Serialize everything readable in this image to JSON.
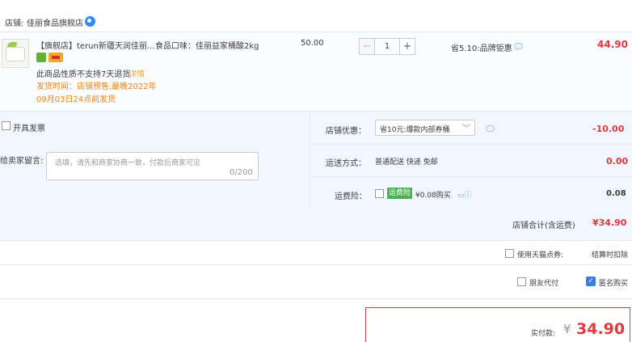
{
  "shop": {
    "label": "店铺:",
    "name": "佳丽食品旗舰店"
  },
  "item": {
    "title": "【旗舰店】terun新疆天润佳丽...",
    "sku": "食品口味：佳丽益家桶酸2kg",
    "price": "50.00",
    "quantity": "1",
    "minus": "−",
    "plus": "+",
    "promo": "省5.10:品牌钜惠",
    "subtotal": "44.90",
    "no_return": "此商品性质不支持7天退货",
    "detail_link": "详情",
    "ship_time_line1": "发货时间：店铺预售,最晚2022年",
    "ship_time_line2": "09月03日24点前发货"
  },
  "options": {
    "invoice_label": "开具发票",
    "memo_label": "给卖家留言:",
    "memo_placeholder": "选填，请先和商家协商一致，付款后商家可见",
    "memo_count": "0/200",
    "coupon_label": "店铺优惠：",
    "coupon_value": "省10元:爆款内部券桶",
    "discount": "-10.00",
    "shipping_label": "运送方式：",
    "shipping_method": "普通配送 快递 免邮",
    "shipping_fee": "0.00",
    "insurance_label": "运费险：",
    "insurance_tag": "运费险",
    "insurance_price": "¥0.08购买",
    "insurance_amount": "0.08"
  },
  "totals": {
    "shop_total_label": "店铺合计(含运费)",
    "shop_total_value": "¥34.90",
    "points_label": "使用天猫点券:",
    "points_info": "结算时扣除",
    "friend_pay": "朋友代付",
    "anonymous": "匿名购买",
    "final_label": "实付款:",
    "final_currency": "¥",
    "final_value": "34.90"
  },
  "colors": {
    "accent_red": "#e4393c",
    "orange": "#f5820a",
    "panel_blue": "#f2f7ff"
  }
}
